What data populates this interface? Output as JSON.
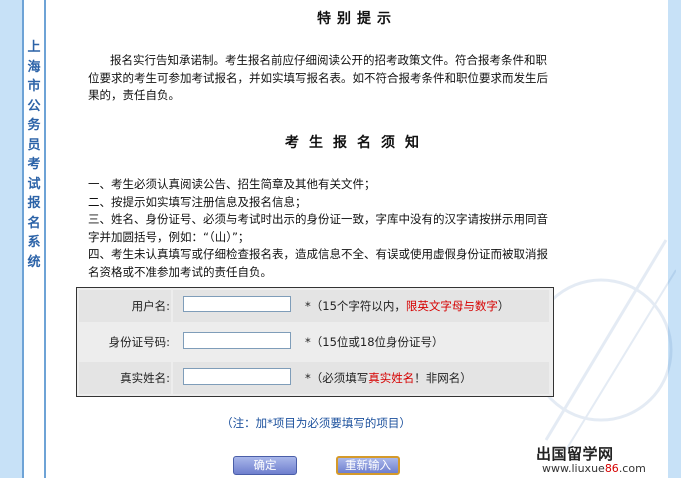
{
  "sidebar": {
    "vertical_title": [
      "上",
      "海",
      "市",
      "公",
      "务",
      "员",
      "考",
      "试",
      "报",
      "名",
      "系",
      "统"
    ]
  },
  "notice": {
    "title": "特别提示",
    "paragraph": "报名实行告知承诺制。考生报名前应仔细阅读公开的招考政策文件。符合报考条件和职位要求的考生可参加考试报名，并如实填写报名表。如不符合报考条件和职位要求而发生后果的，责任自负。"
  },
  "rules_section": {
    "title": "考生报名须知",
    "items": [
      "一、考生必须认真阅读公告、招生简章及其他有关文件；",
      "二、按提示如实填写注册信息及报名信息；",
      "三、姓名、身份证号、必须与考试时出示的身份证一致，字库中没有的汉字请按拼示用同音字并加圆括号，例如：“（山）”；",
      "四、考生未认真填写或仔细检查报名表，造成信息不全、有误或使用虚假身份证而被取消报名资格或不准参加考试的责任自负。"
    ]
  },
  "form": {
    "username": {
      "label": "用户名:",
      "value": "",
      "hint_prefix": "*（15个字符以内，",
      "hint_red": "限英文字母与数字",
      "hint_suffix": "）"
    },
    "id_number": {
      "label": "身份证号码:",
      "value": "",
      "hint_prefix": "*（15位或18位身份证号）",
      "hint_red": "",
      "hint_suffix": ""
    },
    "real_name": {
      "label": "真实姓名:",
      "value": "",
      "hint_prefix": "*（必须填写",
      "hint_red": "真实姓名",
      "hint_suffix": "！非网名）"
    }
  },
  "note": "（注：加*项目为必须要填写的项目）",
  "buttons": {
    "ok": "确定",
    "reset": "重新输入"
  },
  "watermark": {
    "brand": "出国留学网",
    "url_prefix": "www.liuxue",
    "url_red": "86",
    "url_suffix": ".com"
  },
  "colors": {
    "side_bg": "#c7e1f7",
    "side_title": "#2c63a8",
    "red_hint": "#d60000",
    "note_blue": "#1a4f9c"
  }
}
